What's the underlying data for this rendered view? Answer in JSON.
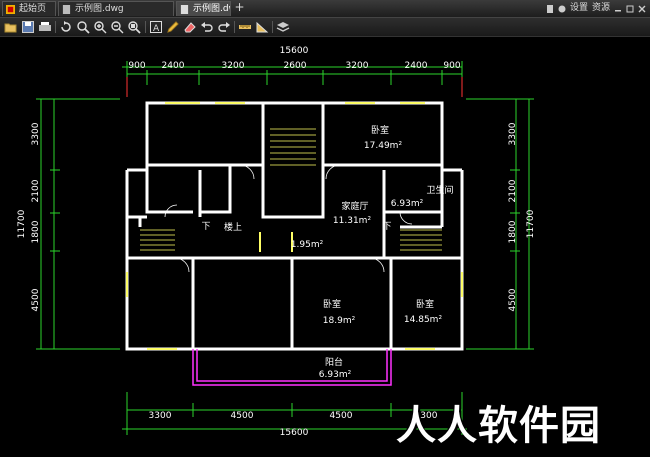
{
  "tabs": [
    {
      "label": "起始页",
      "active": false
    },
    {
      "label": "示例图.dwg",
      "active": false
    },
    {
      "label": "示例图.dwg",
      "active": true
    }
  ],
  "add_tab_label": "+",
  "menu": {
    "settings": "设置",
    "resources": "资源"
  },
  "toolbar": {
    "icons": [
      "open-icon",
      "save-icon",
      "print-icon",
      "rotate-icon",
      "zoom-icon",
      "zoom-in-icon",
      "zoom-out-icon",
      "zoom-window-icon",
      "text-icon",
      "pencil-icon",
      "eraser-icon",
      "undo-icon",
      "redo-icon",
      "measure-icon",
      "area-icon",
      "layers-icon"
    ]
  },
  "drawing": {
    "dim_top_total": "15600",
    "dim_top": [
      "900",
      "2400",
      "3200",
      "2600",
      "3200",
      "2400",
      "900"
    ],
    "dim_left_total": "11700",
    "dim_left": [
      "3300",
      "2100",
      "1800",
      "4500"
    ],
    "dim_right_total": "11700",
    "dim_right": [
      "3300",
      "2100",
      "1800",
      "4500"
    ],
    "dim_bottom": [
      "3300",
      "4500",
      "4500",
      "3300"
    ],
    "dim_bottom_total": "15600",
    "rooms": {
      "bedroom_ne": "卧室",
      "bedroom_ne_area": "17.49m²",
      "bathroom": "卫生间",
      "bathroom_area": "6.93m²",
      "family_hall": "家庭厅",
      "family_hall_area": "11.31m²",
      "stairs_up": "楼上",
      "down_left": "下",
      "down_right": "下",
      "small_area": "1.95m²",
      "bedroom_s": "卧室",
      "bedroom_s_area": "18.9m²",
      "bedroom_se": "卧室",
      "bedroom_se_area": "14.85m²",
      "balcony": "阳台",
      "balcony_area": "6.93m²"
    }
  },
  "watermark": "人人软件园",
  "colors": {
    "background": "#000000",
    "walls": "#ffffff",
    "dimensions": "#00ff00",
    "windows": "#ffff66",
    "balcony": "#ff33ff",
    "axes": "#ff3333"
  }
}
